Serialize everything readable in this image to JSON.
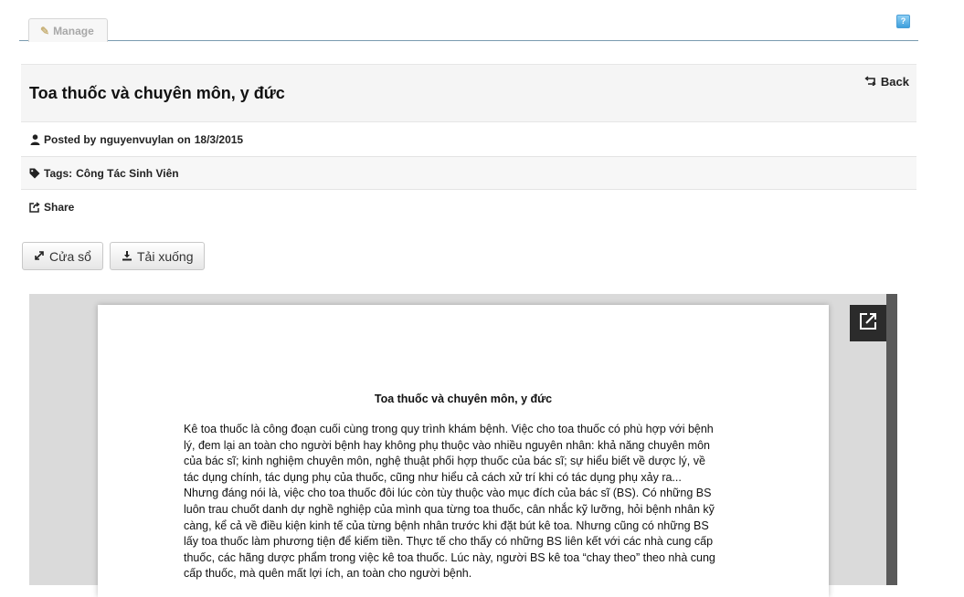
{
  "toolbar": {
    "manage_label": "Manage",
    "help_icon": "help-icon"
  },
  "post": {
    "title": "Toa thuốc và chuyên môn, y đức",
    "back_label": "Back",
    "posted_by_prefix": "Posted by",
    "author": "nguyenvuylan",
    "on_word": "on",
    "date": "18/3/2015",
    "tags_prefix": "Tags:",
    "tags": "Công Tác Sinh Viên",
    "share_label": "Share"
  },
  "actions": {
    "window_label": "Cửa sổ",
    "download_label": "Tải xuống"
  },
  "document": {
    "title": "Toa thuốc và chuyên môn, y đức",
    "lines": [
      "Kê toa thuốc là công đoạn cuối cùng trong quy trình khám bệnh. Việc cho toa thuốc có phù hợp với bệnh",
      "lý, đem lại an toàn cho người bệnh hay không phụ thuộc vào nhiều nguyên nhân: khả năng chuyên môn",
      "của bác sĩ; kinh nghiệm chuyên môn, nghệ thuật phối hợp thuốc của bác sĩ; sự hiểu biết về dược lý, về",
      "tác dụng chính, tác dụng phụ của thuốc, cũng như hiểu cả cách xử trí khi có tác dụng phụ xảy ra...",
      "Nhưng đáng nói là, việc cho toa thuốc đôi lúc còn tùy thuộc vào mục đích của bác sĩ (BS). Có những BS",
      "luôn trau chuốt danh dự nghề nghiệp của mình qua từng toa thuốc, cân nhắc kỹ lưỡng, hỏi bệnh nhân kỹ",
      "càng, kể cả về điều kiện kinh tế của từng bệnh nhân trước khi đặt bút kê toa. Nhưng cũng có những BS",
      "lấy toa thuốc làm phương tiện để kiếm tiền. Thực tế cho thấy có những BS liên kết với các nhà cung cấp",
      "thuốc, các hãng dược phẩm trong việc kê toa thuốc. Lúc này, người BS kê toa “chay theo” theo nhà cung",
      "cấp thuốc, mà quên mất lợi ích, an toàn cho người bệnh."
    ]
  }
}
